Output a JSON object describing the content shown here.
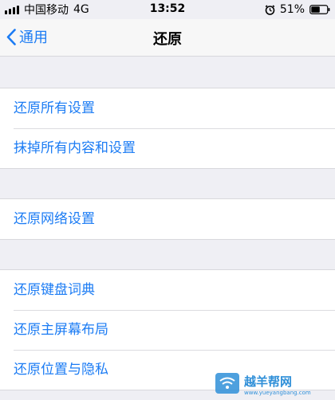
{
  "status_bar": {
    "carrier": "中国移动",
    "network": "4G",
    "time": "13:52",
    "battery": "51%"
  },
  "nav": {
    "back_label": "通用",
    "title": "还原"
  },
  "groups": [
    {
      "items": [
        {
          "label": "还原所有设置"
        },
        {
          "label": "抹掉所有内容和设置"
        }
      ]
    },
    {
      "items": [
        {
          "label": "还原网络设置"
        }
      ]
    },
    {
      "items": [
        {
          "label": "还原键盘词典"
        },
        {
          "label": "还原主屏幕布局"
        },
        {
          "label": "还原位置与隐私"
        }
      ]
    }
  ],
  "watermark": {
    "title": "越羊帮网",
    "url": "www.yueyangbang.com"
  },
  "colors": {
    "accent": "#1c7cf4",
    "background": "#efeff4"
  }
}
